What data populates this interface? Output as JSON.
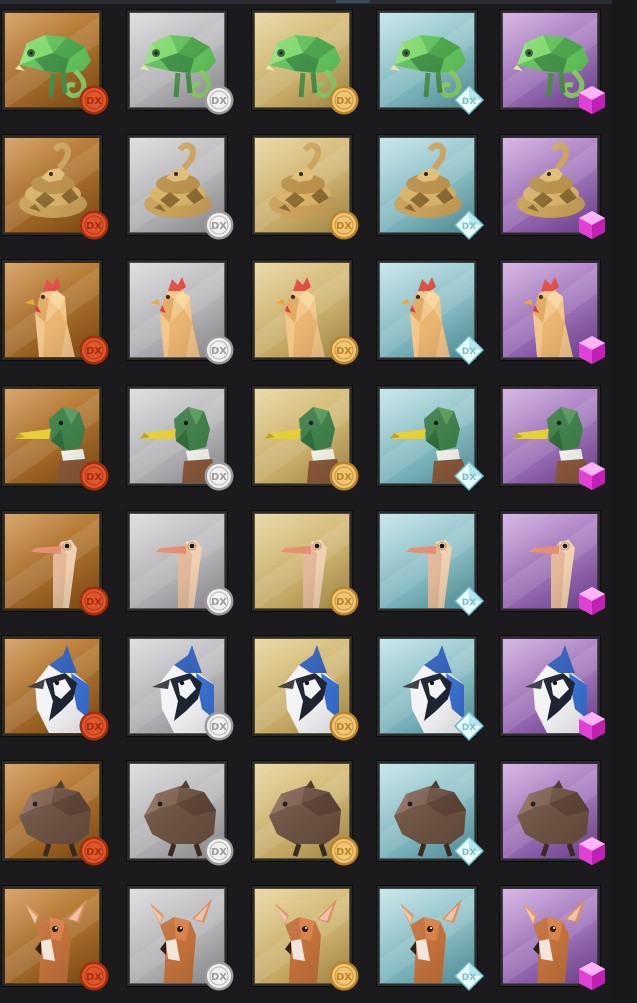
{
  "rarities": [
    {
      "id": "bronze",
      "bg1": "#c98a3e",
      "bg2": "#8a5418",
      "badge": "coin-bronze",
      "coin1": "#e0562a",
      "coin2": "#a22e10"
    },
    {
      "id": "silver",
      "bg1": "#d4d4d6",
      "bg2": "#9a9a9e",
      "badge": "coin-silver",
      "coin1": "#f0f0f0",
      "coin2": "#9c9c9c"
    },
    {
      "id": "gold",
      "bg1": "#e3cd8e",
      "bg2": "#b89a52",
      "badge": "coin-gold",
      "coin1": "#f0c470",
      "coin2": "#b8852e"
    },
    {
      "id": "diamond",
      "bg1": "#b9dfe3",
      "bg2": "#5d9ea8",
      "badge": "diamond-gem",
      "coin1": "#e8ffff",
      "coin2": "#8fd8e6"
    },
    {
      "id": "epic",
      "bg1": "#c7a1d8",
      "bg2": "#7a4a9c",
      "badge": "cube-gem",
      "coin1": "#ff7bf0",
      "coin2": "#c21fb4"
    }
  ],
  "animals": [
    {
      "id": "chameleon",
      "icon": "chameleon-icon"
    },
    {
      "id": "snake",
      "icon": "snake-icon"
    },
    {
      "id": "chicken",
      "icon": "chicken-icon"
    },
    {
      "id": "duck",
      "icon": "duck-icon"
    },
    {
      "id": "ostrich",
      "icon": "ostrich-icon"
    },
    {
      "id": "blue-jay",
      "icon": "blue-jay-icon"
    },
    {
      "id": "beaver",
      "icon": "beaver-icon"
    },
    {
      "id": "deer",
      "icon": "deer-icon"
    }
  ],
  "badge_text": "DX"
}
